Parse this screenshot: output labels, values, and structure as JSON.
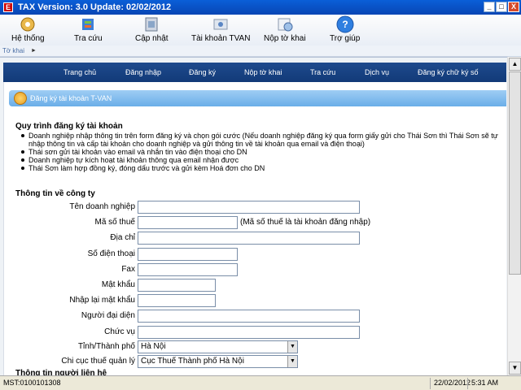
{
  "window": {
    "title": "TAX Version: 3.0 Update: 02/02/2012",
    "controls": [
      "_",
      "□",
      "X"
    ]
  },
  "toolbar": {
    "items": [
      {
        "label": "Hệ thống",
        "icon": "system-icon"
      },
      {
        "label": "Tra cứu",
        "icon": "lookup-icon"
      },
      {
        "label": "Cập nhật",
        "icon": "update-icon"
      },
      {
        "label": "Tài khoản TVAN",
        "icon": "account-icon"
      },
      {
        "label": "Nộp tờ khai",
        "icon": "submit-icon"
      },
      {
        "label": "Trợ giúp",
        "icon": "help-icon"
      }
    ]
  },
  "breadcrumb": {
    "label": "Tờ khai",
    "arrow": "►"
  },
  "nav": {
    "items": [
      "Trang chủ",
      "Đăng nhập",
      "Đăng ký",
      "Nộp tờ khai",
      "Tra cứu",
      "Dịch vụ",
      "Đăng ký chữ ký số"
    ]
  },
  "banner": {
    "title": "Đăng ký tài khoản T-VAN"
  },
  "process": {
    "title": "Quy trình đăng ký tài khoản",
    "steps": [
      "Doanh nghiệp nhập thông tin trên form đăng ký và chọn gói cước (Nếu doanh nghiệp đăng ký qua form giấy gửi cho Thái Sơn thì Thái Sơn sẽ tự nhập thông tin và cấp tài khoản cho doanh nghiệp và gửi thông tin về tài khoản qua email và điện thoại)",
      "Thái sơn gửi tài khoản vào email và nhắn tin vào điện thoại cho DN",
      "Doanh nghiệp tự kích hoạt tài khoản thông qua email nhận được",
      "Thái Sơn làm hợp đồng ký, đóng dấu trước và gửi kèm Hoá đơn cho DN"
    ]
  },
  "company": {
    "title": "Thông tin về công ty",
    "fields": {
      "name": {
        "label": "Tên doanh nghiệp",
        "value": ""
      },
      "tax_code": {
        "label": "Mã số thuế",
        "value": "",
        "note": "(Mã số thuế là tài khoản đăng nhập)"
      },
      "address": {
        "label": "Địa chỉ",
        "value": ""
      },
      "phone": {
        "label": "Số điện thoại",
        "value": ""
      },
      "fax": {
        "label": "Fax",
        "value": ""
      },
      "password": {
        "label": "Mật khẩu",
        "value": ""
      },
      "password_confirm": {
        "label": "Nhập lại mật khẩu",
        "value": ""
      },
      "representative": {
        "label": "Người đại diện",
        "value": ""
      },
      "position": {
        "label": "Chức vụ",
        "value": ""
      },
      "province": {
        "label": "Tỉnh/Thành phố",
        "value": "Hà Nội"
      },
      "tax_office": {
        "label": "Chi cục thuế quản lý",
        "value": "Cục Thuế Thành phố Hà Nội"
      }
    }
  },
  "contact": {
    "title": "Thông tin người liên hệ"
  },
  "status": {
    "mst": "MST:0100101308",
    "date": "22/02/2012",
    "time": "5:31 AM"
  }
}
